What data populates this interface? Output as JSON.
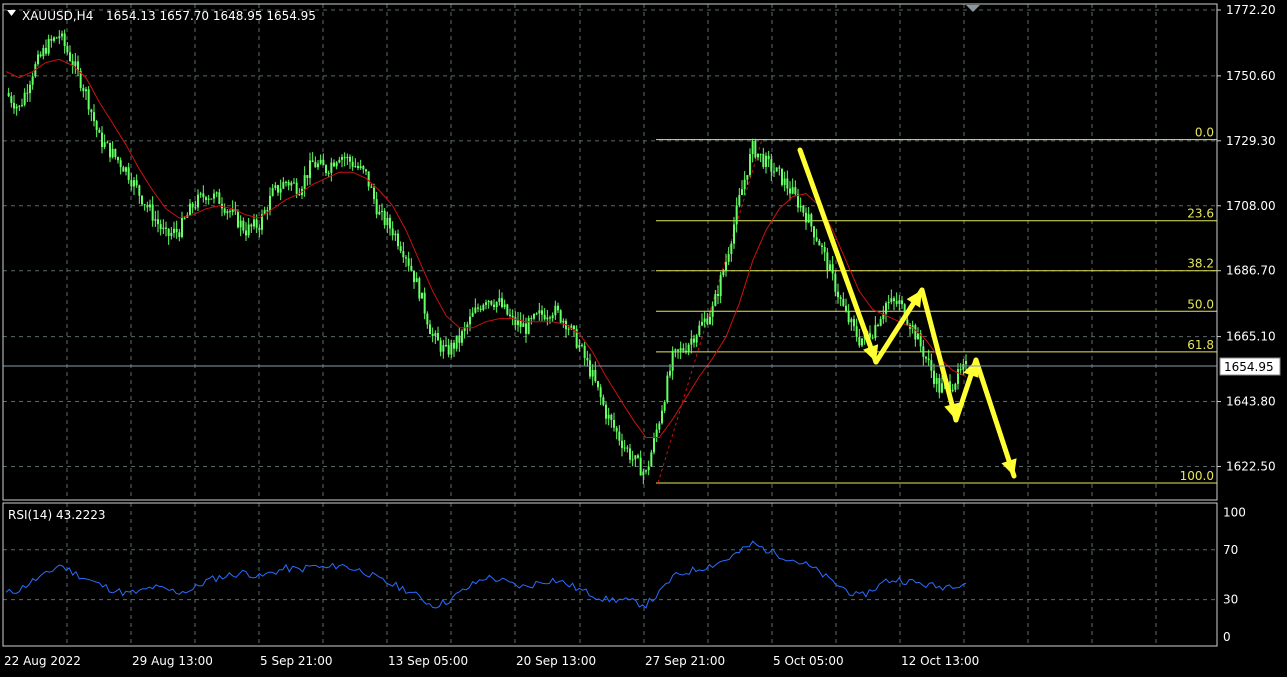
{
  "header": {
    "symbol": "XAUUSD,H4",
    "ohlc": "1654.13 1657.70 1648.95 1654.95"
  },
  "price_axis": {
    "ticks": [
      "1772.20",
      "1750.60",
      "1729.30",
      "1708.00",
      "1686.70",
      "1665.10",
      "1643.80",
      "1622.50"
    ],
    "current_price": "1654.95"
  },
  "time_axis": {
    "ticks": [
      "22 Aug 2022",
      "29 Aug 13:00",
      "5 Sep 21:00",
      "13 Sep 05:00",
      "20 Sep 13:00",
      "27 Sep 21:00",
      "5 Oct 05:00",
      "12 Oct 13:00"
    ]
  },
  "rsi": {
    "label": "RSI(14) 43.2223",
    "levels": [
      "100",
      "70",
      "30",
      "0"
    ]
  },
  "fibonacci": {
    "levels": [
      {
        "label": "0.0",
        "price": 1729.7
      },
      {
        "label": "23.6",
        "price": 1703.1
      },
      {
        "label": "38.2",
        "price": 1686.7
      },
      {
        "label": "50.0",
        "price": 1673.4
      },
      {
        "label": "61.8",
        "price": 1660.1
      },
      {
        "label": "100.0",
        "price": 1617.1
      }
    ]
  },
  "colors": {
    "background": "#000000",
    "grid": "#5a6a6a",
    "candles": "#66ff66",
    "moving_average": "#cc1111",
    "fib": "#e6e65a",
    "arrows": "#ffff33",
    "rsi_line": "#2a6cff",
    "text": "#ffffff"
  },
  "chart_data": {
    "type": "line",
    "title": "XAUUSD,H4",
    "x": [
      "22 Aug 2022",
      "29 Aug 13:00",
      "5 Sep 21:00",
      "13 Sep 05:00",
      "20 Sep 13:00",
      "27 Sep 21:00",
      "5 Oct 05:00",
      "12 Oct 13:00"
    ],
    "ylim": [
      1612,
      1775
    ],
    "series": [
      {
        "name": "XAUUSD",
        "values": [
          1745,
          1740,
          1752,
          1760,
          1764,
          1755,
          1745,
          1730,
          1725,
          1720,
          1712,
          1705,
          1698,
          1700,
          1708,
          1712,
          1710,
          1705,
          1700,
          1702,
          1712,
          1716,
          1714,
          1722,
          1720,
          1725,
          1722,
          1718,
          1705,
          1700,
          1692,
          1680,
          1665,
          1660,
          1664,
          1672,
          1678,
          1676,
          1670,
          1668,
          1672,
          1674,
          1670,
          1662,
          1652,
          1640,
          1632,
          1625,
          1620,
          1638,
          1658,
          1662,
          1668,
          1674,
          1690,
          1710,
          1727,
          1722,
          1718,
          1712,
          1705,
          1696,
          1684,
          1672,
          1664,
          1667,
          1676,
          1676,
          1668,
          1658,
          1648,
          1650,
          1654.95
        ]
      },
      {
        "name": "MA",
        "values": [
          1752,
          1750,
          1752,
          1755,
          1756,
          1754,
          1750,
          1742,
          1735,
          1728,
          1720,
          1713,
          1707,
          1704,
          1705,
          1707,
          1708,
          1707,
          1705,
          1704,
          1707,
          1710,
          1712,
          1715,
          1717,
          1719,
          1719,
          1717,
          1713,
          1708,
          1700,
          1690,
          1680,
          1672,
          1668,
          1668,
          1670,
          1671,
          1671,
          1670,
          1670,
          1670,
          1669,
          1666,
          1660,
          1652,
          1645,
          1638,
          1632,
          1632,
          1638,
          1645,
          1652,
          1658,
          1665,
          1676,
          1690,
          1700,
          1707,
          1711,
          1712,
          1708,
          1700,
          1690,
          1680,
          1674,
          1672,
          1670,
          1668,
          1664,
          1658,
          1654,
          1652
        ]
      }
    ],
    "rsi": {
      "name": "RSI(14)",
      "ylim": [
        0,
        100
      ],
      "levels": [
        30,
        70
      ],
      "values": [
        35,
        38,
        45,
        50,
        58,
        52,
        47,
        42,
        38,
        35,
        36,
        40,
        38,
        36,
        38,
        45,
        48,
        50,
        52,
        48,
        52,
        55,
        54,
        57,
        55,
        58,
        55,
        52,
        46,
        42,
        38,
        32,
        25,
        28,
        35,
        42,
        48,
        46,
        42,
        40,
        44,
        46,
        43,
        38,
        34,
        30,
        30,
        28,
        26,
        35,
        48,
        52,
        55,
        58,
        62,
        68,
        75,
        70,
        66,
        62,
        58,
        52,
        44,
        38,
        32,
        38,
        45,
        46,
        44,
        42,
        40,
        42,
        43.2
      ]
    }
  }
}
